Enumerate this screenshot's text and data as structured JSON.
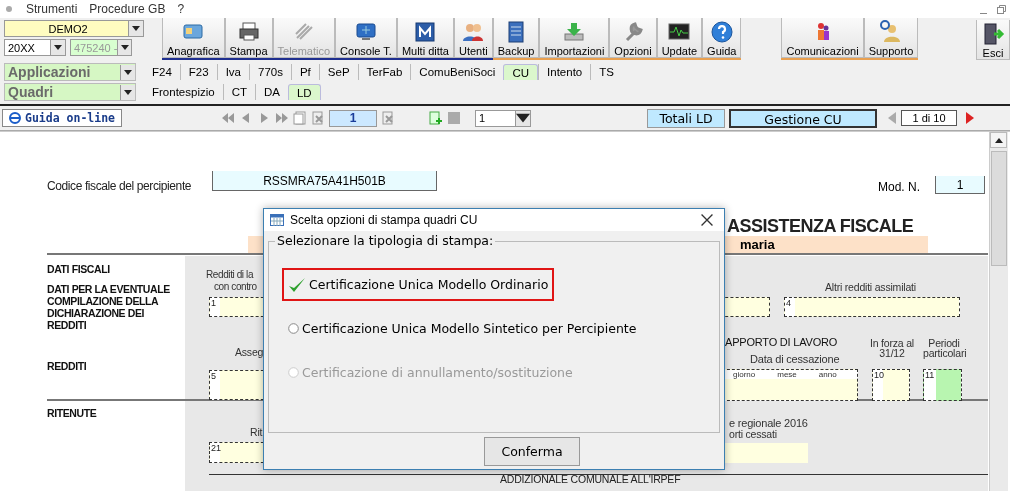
{
  "menu_bar": {
    "items": [
      "Strumenti",
      "Procedure GB",
      "?"
    ]
  },
  "company_selector": {
    "value": "DEMO2"
  },
  "year_selector": {
    "value": "20XX"
  },
  "code_selector": {
    "value": "475240 -",
    "disabled": true
  },
  "toolbar": {
    "groups": [
      [
        {
          "label": "Anagrafica",
          "disabled": false
        },
        {
          "label": "Stampa",
          "disabled": false
        },
        {
          "label": "Telematico",
          "disabled": true
        },
        {
          "label": "Console T.",
          "disabled": false
        },
        {
          "label": "Multi ditta",
          "disabled": false
        },
        {
          "label": "Utenti",
          "disabled": false
        }
      ],
      [
        {
          "label": "Backup",
          "disabled": false
        },
        {
          "label": "Importazioni",
          "disabled": false
        },
        {
          "label": "Opzioni",
          "disabled": false
        },
        {
          "label": "Update",
          "disabled": false
        },
        {
          "label": "Guida",
          "disabled": false
        }
      ],
      [
        {
          "label": "Comunicazioni",
          "disabled": false
        },
        {
          "label": "Supporto",
          "disabled": false
        }
      ],
      [
        {
          "label": "Esci",
          "disabled": false
        }
      ]
    ]
  },
  "applications_selector": {
    "value": "Applicazioni"
  },
  "app_tabs": [
    {
      "label": "F24",
      "selected": false
    },
    {
      "label": "F23",
      "selected": false
    },
    {
      "label": "Iva",
      "selected": false
    },
    {
      "label": "770s",
      "selected": false
    },
    {
      "label": "Pf",
      "selected": false
    },
    {
      "label": "SeP",
      "selected": false
    },
    {
      "label": "TerFab",
      "selected": false
    },
    {
      "label": "ComuBeniSoci",
      "selected": false
    },
    {
      "label": "CU",
      "selected": true
    },
    {
      "label": "Intento",
      "selected": false
    },
    {
      "label": "TS",
      "selected": false
    }
  ],
  "sections_selector": {
    "value": "Quadri"
  },
  "section_tabs": [
    {
      "label": "Frontespizio",
      "selected": false
    },
    {
      "label": "CT",
      "selected": false
    },
    {
      "label": "DA",
      "selected": false
    },
    {
      "label": "LD",
      "selected": true
    }
  ],
  "nav_bar": {
    "help_button": "Guida on-line",
    "page_field": "1",
    "record_dropdown": "1",
    "totals_button": "Totali LD",
    "manage_button": "Gestione CU",
    "page_counter": "1 di 10"
  },
  "form": {
    "tax_code_label": "Codice fiscale del percipiente",
    "tax_code": "RSSMRA75A41H501B",
    "model_label": "Mod. N.",
    "model_number": "1",
    "heading": "ASSISTENZA FISCALE",
    "name": "maria",
    "section_labels": [
      "DATI FISCALI",
      "DATI PER LA EVENTUALE COMPILAZIONE DELLA DICHIARAZIONE DEI REDDITI",
      "REDDITI",
      "RITENUTE"
    ],
    "captions": [
      "Redditi di la",
      "con contro",
      "Altri redditi assimilati",
      "Asseg",
      "APPORTO DI LAVORO",
      "Data di cessazione",
      "In forza al 31/12",
      "Periodi particolari",
      "Rit",
      "e regionale 2016",
      "orti cessati",
      "ADDIZIONALE COMUNALE ALL'IRPEF"
    ],
    "field_numbers": [
      "1",
      "4",
      "5",
      "10",
      "11",
      "21"
    ],
    "date_parts": [
      "giorno",
      "mese",
      "anno"
    ]
  },
  "dialog": {
    "title": "Scelta opzioni di stampa quadri CU",
    "group_label": "Selezionare la tipologia di stampa:",
    "options": [
      {
        "label": "Certificazione Unica Modello Ordinario",
        "selected": true,
        "disabled": false
      },
      {
        "label": "Certificazione Unica Modello Sintetico per Percipiente",
        "selected": false,
        "disabled": false
      },
      {
        "label": "Certificazione di annullamento/sostituzione",
        "selected": false,
        "disabled": true
      }
    ],
    "confirm_button": "Conferma"
  }
}
